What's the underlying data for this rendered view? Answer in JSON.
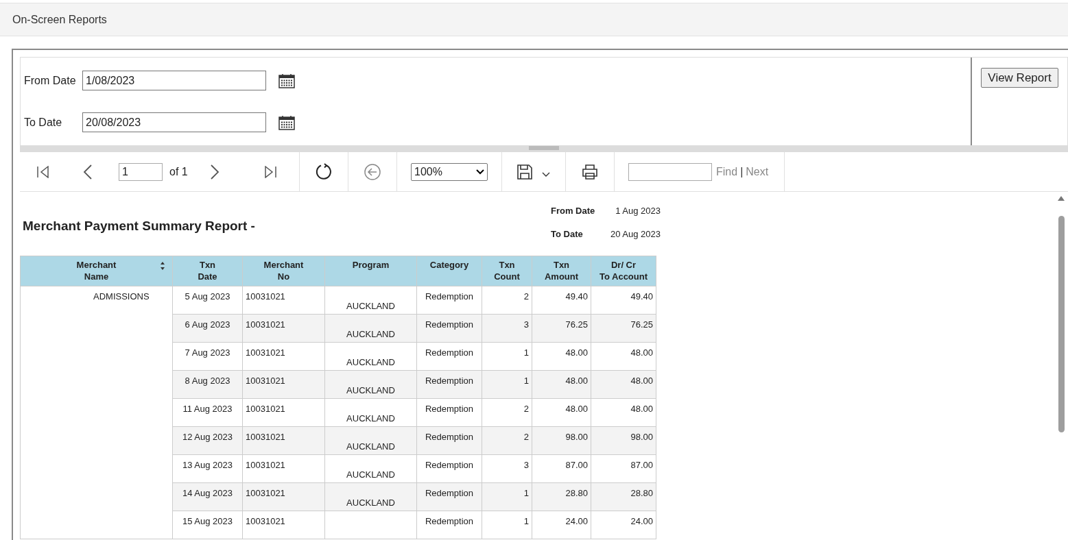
{
  "page_title": "On-Screen Reports",
  "parameters": [
    {
      "label": "From Date",
      "value": "1/08/2023"
    },
    {
      "label": "To Date",
      "value": "20/08/2023"
    }
  ],
  "view_button": "View Report",
  "toolbar": {
    "page": "1",
    "of": "of 1",
    "zoom": "100%",
    "find": "Find",
    "separator": "|",
    "next": "Next"
  },
  "report": {
    "title": "Merchant Payment Summary Report -",
    "meta": [
      {
        "label": "From Date",
        "value": "1 Aug 2023"
      },
      {
        "label": "To Date",
        "value": "20 Aug 2023"
      }
    ],
    "columns": [
      {
        "line1": "Merchant",
        "line2": "Name"
      },
      {
        "line1": "Txn",
        "line2": "Date"
      },
      {
        "line1": "Merchant",
        "line2": "No"
      },
      {
        "line1": "Program"
      },
      {
        "line1": "Category"
      },
      {
        "line1": "Txn",
        "line2": "Count"
      },
      {
        "line1": "Txn",
        "line2": "Amount"
      },
      {
        "line1": "Dr/ Cr",
        "line2": "To Account"
      }
    ],
    "merchant_name": "ADMISSIONS",
    "rows": [
      {
        "date": "5 Aug 2023",
        "merchant_no": "10031021",
        "program": "AUCKLAND",
        "category": "Redemption",
        "count": "2",
        "amount": "49.40",
        "account": "49.40"
      },
      {
        "date": "6 Aug 2023",
        "merchant_no": "10031021",
        "program": "AUCKLAND",
        "category": "Redemption",
        "count": "3",
        "amount": "76.25",
        "account": "76.25"
      },
      {
        "date": "7 Aug 2023",
        "merchant_no": "10031021",
        "program": "AUCKLAND",
        "category": "Redemption",
        "count": "1",
        "amount": "48.00",
        "account": "48.00"
      },
      {
        "date": "8 Aug 2023",
        "merchant_no": "10031021",
        "program": "AUCKLAND",
        "category": "Redemption",
        "count": "1",
        "amount": "48.00",
        "account": "48.00"
      },
      {
        "date": "11 Aug 2023",
        "merchant_no": "10031021",
        "program": "AUCKLAND",
        "category": "Redemption",
        "count": "2",
        "amount": "48.00",
        "account": "48.00"
      },
      {
        "date": "12 Aug 2023",
        "merchant_no": "10031021",
        "program": "AUCKLAND",
        "category": "Redemption",
        "count": "2",
        "amount": "98.00",
        "account": "98.00"
      },
      {
        "date": "13 Aug 2023",
        "merchant_no": "10031021",
        "program": "AUCKLAND",
        "category": "Redemption",
        "count": "3",
        "amount": "87.00",
        "account": "87.00"
      },
      {
        "date": "14 Aug 2023",
        "merchant_no": "10031021",
        "program": "AUCKLAND",
        "category": "Redemption",
        "count": "1",
        "amount": "28.80",
        "account": "28.80"
      },
      {
        "date": "15 Aug 2023",
        "merchant_no": "10031021",
        "category": "Redemption",
        "count": "1",
        "amount": "24.00",
        "account": "24.00"
      }
    ]
  }
}
